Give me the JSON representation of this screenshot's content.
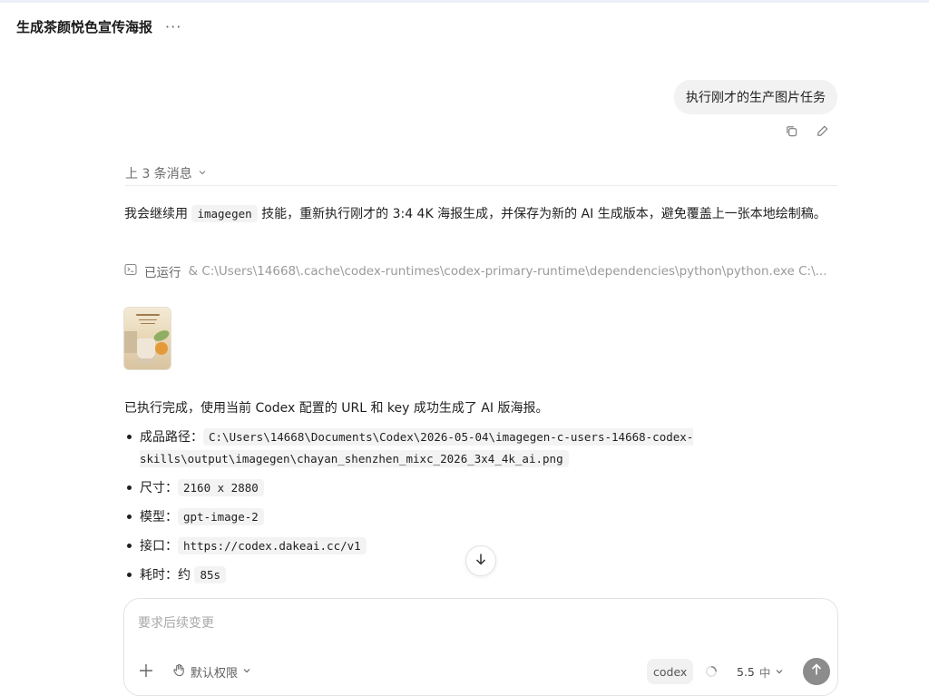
{
  "header": {
    "title": "生成茶颜悦色宣传海报",
    "more_label": "···"
  },
  "user_message": {
    "text": "执行刚才的生产图片任务"
  },
  "previous_messages": {
    "label": "上 3 条消息"
  },
  "assistant": {
    "para1": {
      "before": "我会继续用 ",
      "code": "imagegen",
      "after": " 技能，重新执行刚才的 3:4 4K 海报生成，并保存为新的 AI 生成版本，避免覆盖上一张本地绘制稿。"
    },
    "ran": {
      "label": "已运行",
      "command": "& C:\\Users\\14668\\.cache\\codex-runtimes\\codex-primary-runtime\\dependencies\\python\\python.exe C:\\..."
    },
    "thumbnail": {
      "text": "茶颜悦色"
    },
    "para2": "已执行完成，使用当前 Codex 配置的 URL 和 key 成功生成了 AI 版海报。",
    "items": [
      {
        "label": "成品路径：",
        "value": "C:\\Users\\14668\\Documents\\Codex\\2026-05-04\\imagegen-c-users-14668-codex-skills\\output\\imagegen\\chayan_shenzhen_mixc_2026_3x4_4k_ai.png"
      },
      {
        "label": "尺寸：",
        "value": "2160 x 2880"
      },
      {
        "label": "模型：",
        "value": "gpt-image-2"
      },
      {
        "label": "接口：",
        "value": "https://codex.dakeai.cc/v1"
      },
      {
        "label": "耗时：约 ",
        "value": "85s"
      }
    ]
  },
  "composer": {
    "placeholder": "要求后续变更",
    "permission_label": "默认权限",
    "codex_chip": "codex",
    "model_version": "5.5",
    "model_level": "中"
  },
  "icons": {
    "more": "more-icon",
    "copy": "copy-icon",
    "edit": "edit-icon",
    "chevron": "chevron-down-icon",
    "terminal": "terminal-icon",
    "arrow_down": "arrow-down-icon",
    "plus": "plus-icon",
    "hand": "hand-icon",
    "spinner": "spinner-icon",
    "send": "arrow-up-icon"
  }
}
